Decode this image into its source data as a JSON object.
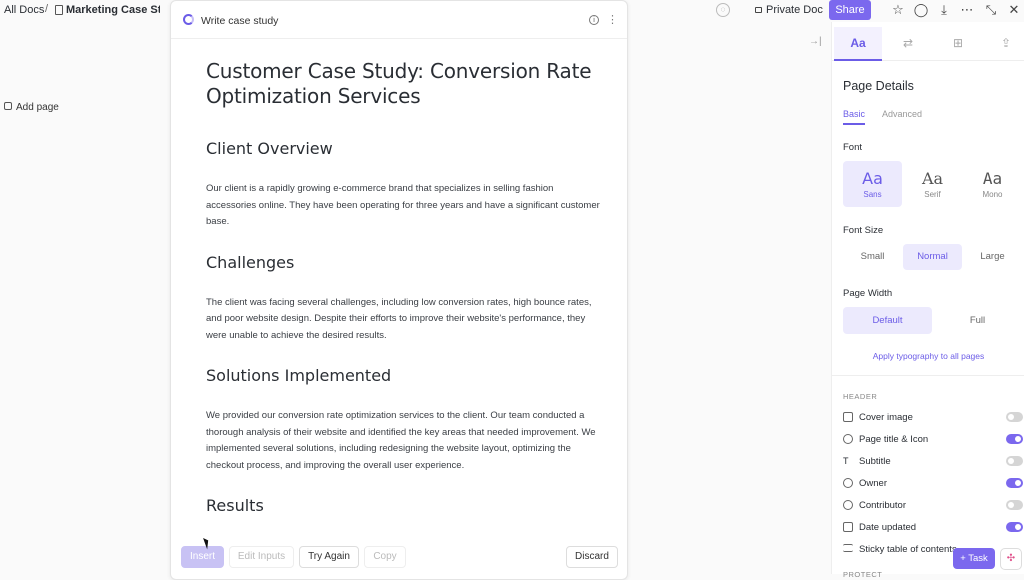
{
  "topbar": {
    "breadcrumb_root": "All Docs",
    "breadcrumb_sep": "/",
    "breadcrumb_doc": "Marketing Case Stud",
    "private_label": "Private Doc",
    "share_label": "Share"
  },
  "left": {
    "add_page_label": "Add page"
  },
  "modal": {
    "title": "Write case study",
    "doc": {
      "title": "Customer Case Study: Conversion Rate Optimization Services",
      "sections": [
        {
          "heading": "Client Overview",
          "body": "Our client is a rapidly growing e-commerce brand that specializes in selling fashion accessories online. They have been operating for three years and have a significant customer base."
        },
        {
          "heading": "Challenges",
          "body": "The client was facing several challenges, including low conversion rates, high bounce rates, and poor website design. Despite their efforts to improve their website's performance, they were unable to achieve the desired results."
        },
        {
          "heading": "Solutions Implemented",
          "body": "We provided our conversion rate optimization services to the client. Our team conducted a thorough analysis of their website and identified the key areas that needed improvement. We implemented several solutions, including redesigning the website layout, optimizing the checkout process, and improving the overall user experience."
        },
        {
          "heading": "Results",
          "body": ""
        }
      ]
    },
    "actions": {
      "insert": "Insert",
      "edit_inputs": "Edit Inputs",
      "try_again": "Try Again",
      "copy": "Copy",
      "discard": "Discard"
    }
  },
  "sidebar": {
    "tabs": [
      "Aa",
      "⇄",
      "⊞",
      "⇪"
    ],
    "page_details_title": "Page Details",
    "subtab_basic": "Basic",
    "subtab_advanced": "Advanced",
    "font_label": "Font",
    "fonts": [
      {
        "glyph": "Aa",
        "name": "Sans",
        "selected": true
      },
      {
        "glyph": "Aa",
        "name": "Serif",
        "selected": false
      },
      {
        "glyph": "Aa",
        "name": "Mono",
        "selected": false
      }
    ],
    "font_size_label": "Font Size",
    "sizes": [
      "Small",
      "Normal",
      "Large"
    ],
    "selected_size": "Normal",
    "page_width_label": "Page Width",
    "widths": [
      "Default",
      "Full"
    ],
    "selected_width": "Default",
    "apply_link": "Apply typography to all pages",
    "header_section": "HEADER",
    "toggles": [
      {
        "label": "Cover image",
        "on": false
      },
      {
        "label": "Page title & Icon",
        "on": true
      },
      {
        "label": "Subtitle",
        "on": false
      },
      {
        "label": "Owner",
        "on": true
      },
      {
        "label": "Contributor",
        "on": false
      },
      {
        "label": "Date updated",
        "on": true
      },
      {
        "label": "Sticky table of contents",
        "on": false
      }
    ],
    "bottom_section": "PROTECT"
  },
  "floating": {
    "task_label": "Task",
    "task_plus": "+"
  },
  "colors": {
    "accent": "#7b68ee",
    "accent_light": "#eceafd"
  }
}
